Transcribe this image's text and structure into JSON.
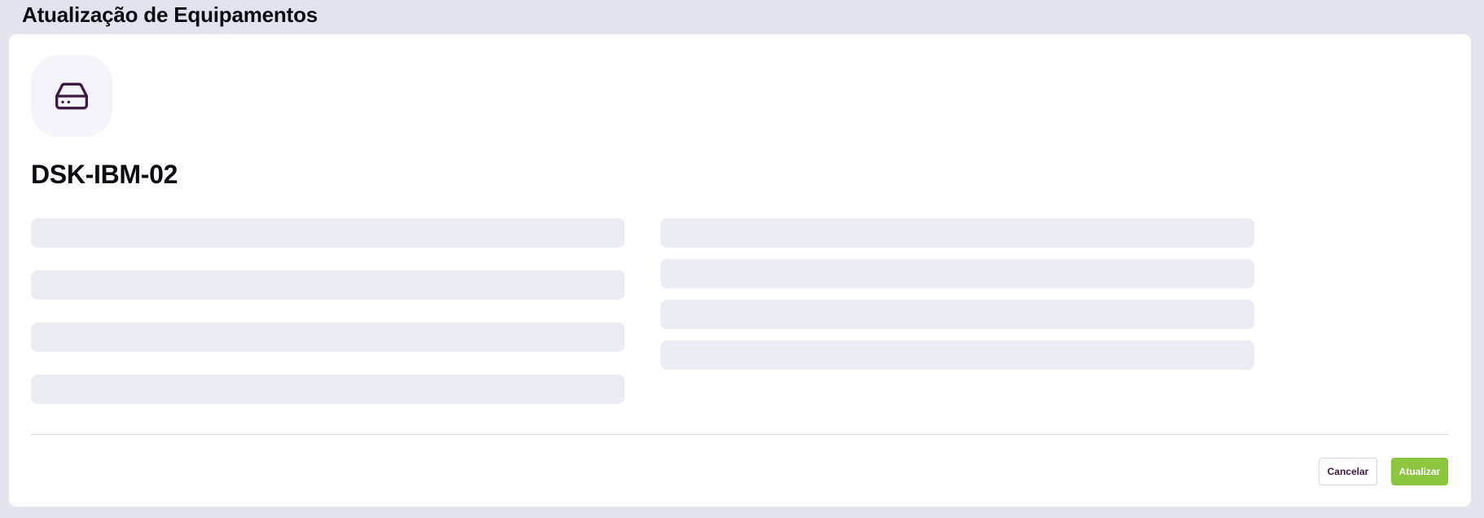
{
  "page": {
    "title": "Atualização de Equipamentos"
  },
  "device": {
    "icon": "hard-drive-icon",
    "name": "DSK-IBM-02"
  },
  "form": {
    "state": "loading",
    "left_column_placeholders": 4,
    "right_column_placeholders": 4
  },
  "actions": {
    "cancel_label": "Cancelar",
    "update_label": "Atualizar"
  },
  "colors": {
    "page_background": "#e2e3ec",
    "card_background": "#ffffff",
    "icon_stroke": "#3c1a44",
    "icon_background": "#f6f4fb",
    "skeleton": "#ebebf4",
    "primary_button": "#8cc63f",
    "cancel_text": "#3c1a44"
  }
}
